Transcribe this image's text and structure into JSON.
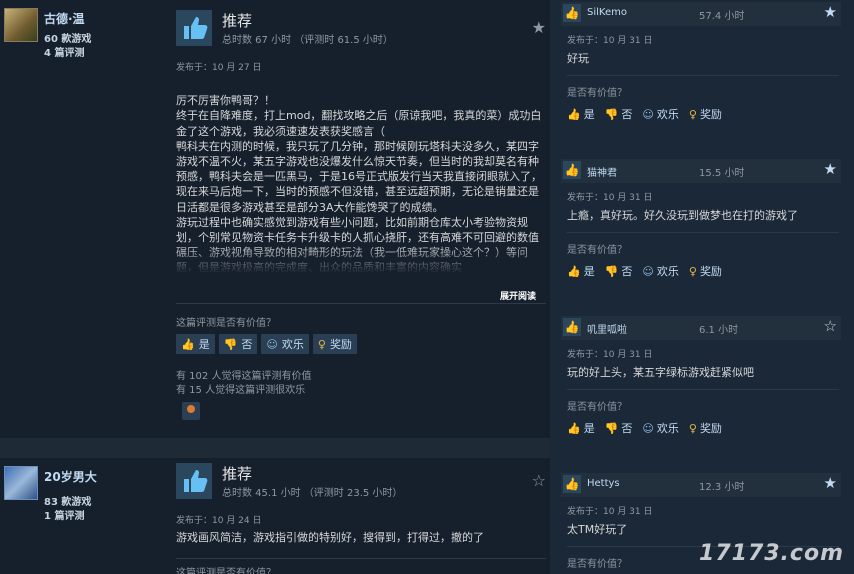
{
  "reviews": [
    {
      "author": "古德·温",
      "games_owned": "60 款游戏",
      "reviews_count": "4 篇评测",
      "title": "推荐",
      "hours": "总时数 67 小时  （评测时 61.5 小时）",
      "posted": "发布于：10 月 27 日",
      "text": "厉不厉害你鸭哥？！\n终于在自降难度，打上mod，翻找攻略之后（原谅我吧，我真的菜）成功白金了这个游戏，我必须速速发表获奖感言（\n鸭科夫在内测的时候，我只玩了几分钟，那时候刚玩塔科夫没多久，某四字游戏不温不火，某五字游戏也没爆发什么惊天节奏，但当时的我却莫名有种预感，鸭科夫会是一匹黑马，于是16号正式版发行当天我直接闭眼就入了，现在来马后炮一下，当时的预感不但没错，甚至远超预期，无论是销量还是日活都是很多游戏甚至是部分3A大作能馋哭了的成绩。\n游玩过程中也确实感觉到游戏有些小问题，比如前期仓库太小考验物资规划，个别常见物资卡任务卡升级卡的人抓心挠肝，还有高难不可回避的数值碾压、游戏视角导致的相对畸形的玩法（我一低难玩家操心这个？）等问题，但是游戏极高的完成度、出众的品质和丰富的内容确实",
      "read_more": "展开阅读",
      "helpful_q": "这篇评测是否有价值？",
      "btn_yes": "是",
      "btn_no": "否",
      "btn_funny": "欢乐",
      "btn_award": "奖励",
      "stat_helpful": "有 102 人觉得这篇评测有价值",
      "stat_funny": "有 15 人觉得这篇评测很欢乐"
    },
    {
      "author": "20岁男大",
      "games_owned": "83 款游戏",
      "reviews_count": "1 篇评测",
      "title": "推荐",
      "hours": "总时数 45.1 小时  （评测时 23.5 小时）",
      "posted": "发布于：10 月 24 日",
      "text": "游戏画风简洁，游戏指引做的特别好，搜得到，打得过，撤的了",
      "helpful_q": "这篇评测是否有价值？"
    }
  ],
  "comments": [
    {
      "name": "SilKemo",
      "hours": "57.4 小时",
      "posted": "发布于：10 月 31 日",
      "text": "好玩",
      "helpful_q": "是否有价值？",
      "yes": "是",
      "no": "否",
      "funny": "欢乐",
      "award": "奖励",
      "starred": true
    },
    {
      "name": "猫神君",
      "hours": "15.5 小时",
      "posted": "发布于：10 月 31 日",
      "text": "上瘾，真好玩。好久没玩到做梦也在打的游戏了",
      "helpful_q": "是否有价值？",
      "yes": "是",
      "no": "否",
      "funny": "欢乐",
      "award": "奖励",
      "starred": true
    },
    {
      "name": "叽里呱啦",
      "hours": "6.1 小时",
      "posted": "发布于：10 月 31 日",
      "text": "玩的好上头，某五字绿标游戏赶紧似吧",
      "helpful_q": "是否有价值？",
      "yes": "是",
      "no": "否",
      "funny": "欢乐",
      "award": "奖励",
      "starred": false
    },
    {
      "name": "Hettys",
      "hours": "12.3 小时",
      "posted": "发布于：10 月 31 日",
      "text": "太TM好玩了",
      "helpful_q": "是否有价值？",
      "starred": true
    }
  ],
  "watermark": "17173.com",
  "colors": {
    "background": "#1b2838",
    "link": "#c1dbf4",
    "muted": "#8f98a0",
    "award": "#e5b64a"
  }
}
